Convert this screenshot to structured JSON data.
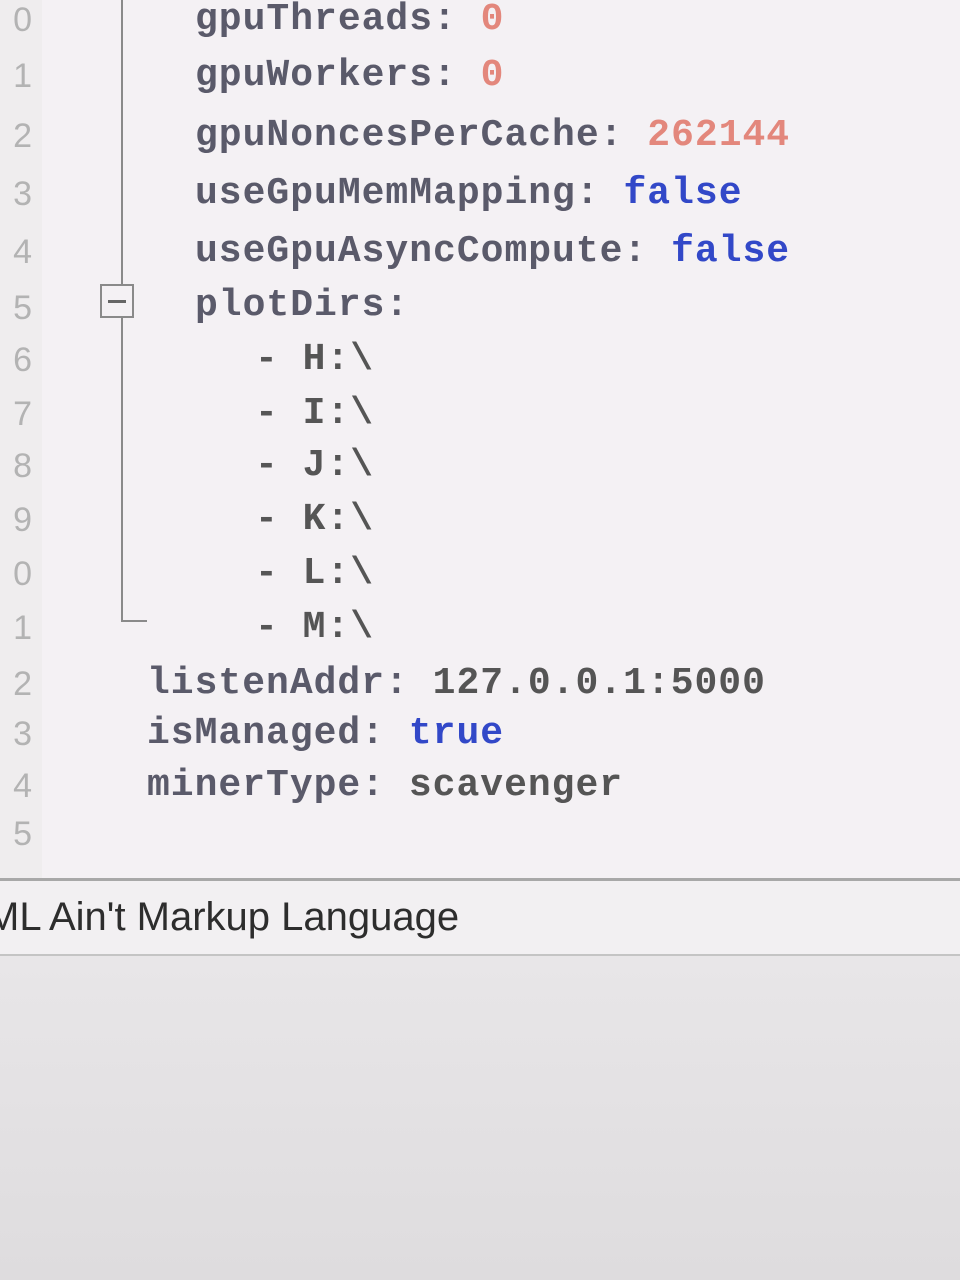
{
  "editor": {
    "line_numbers": [
      "0",
      "1",
      "2",
      "3",
      "4",
      "5",
      "6",
      "7",
      "8",
      "9",
      "0",
      "1",
      "2",
      "3",
      "4",
      "5"
    ],
    "lines": [
      {
        "key": "gpuThreads:",
        "value": "0",
        "value_type": "num"
      },
      {
        "key": "gpuWorkers:",
        "value": "0",
        "value_type": "num"
      },
      {
        "key": "gpuNoncesPerCache:",
        "value": "262144",
        "value_type": "num"
      },
      {
        "key": "useGpuMemMapping:",
        "value": "false",
        "value_type": "bool"
      },
      {
        "key": "useGpuAsyncCompute:",
        "value": "false",
        "value_type": "bool"
      },
      {
        "key": "plotDirs:",
        "value": "",
        "value_type": "plain"
      },
      {
        "key": "",
        "value": "H:\\",
        "value_type": "plain",
        "dash": "-"
      },
      {
        "key": "",
        "value": "I:\\",
        "value_type": "plain",
        "dash": "-"
      },
      {
        "key": "",
        "value": "J:\\",
        "value_type": "plain",
        "dash": "-"
      },
      {
        "key": "",
        "value": "K:\\",
        "value_type": "plain",
        "dash": "-"
      },
      {
        "key": "",
        "value": "L:\\",
        "value_type": "plain",
        "dash": "-"
      },
      {
        "key": "",
        "value": "M:\\",
        "value_type": "plain",
        "dash": "-"
      },
      {
        "key": "listenAddr:",
        "value": "127.0.0.1:5000",
        "value_type": "plain"
      },
      {
        "key": "isManaged:",
        "value": "true",
        "value_type": "bool"
      },
      {
        "key": "minerType:",
        "value": "scavenger",
        "value_type": "plain"
      }
    ]
  },
  "status_bar": {
    "language": "ML Ain't Markup Language"
  },
  "colors": {
    "number": "#e3877c",
    "boolean": "#3248c8",
    "key": "#5a5a6a"
  }
}
